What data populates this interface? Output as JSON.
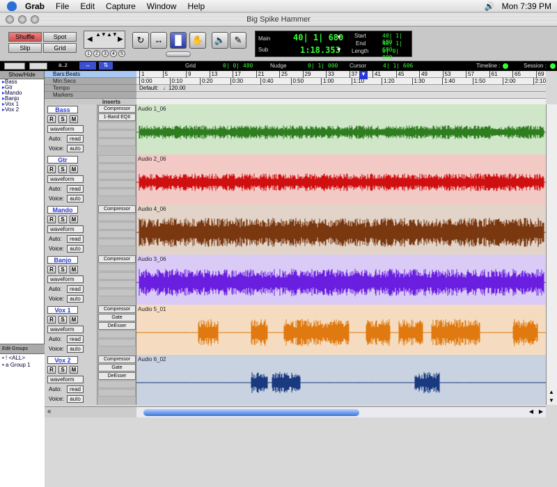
{
  "menubar": {
    "app": "Grab",
    "items": [
      "File",
      "Edit",
      "Capture",
      "Window",
      "Help"
    ],
    "clock": "Mon 7:39 PM"
  },
  "window": {
    "title": "Big Spike Hammer"
  },
  "edit_modes": {
    "shuffle": "Shuffle",
    "spot": "Spot",
    "slip": "Slip",
    "grid": "Grid"
  },
  "zoom_presets": [
    "1",
    "2",
    "3",
    "4",
    "5"
  ],
  "counter": {
    "main_label": "Main",
    "main_value": "40| 1| 680",
    "sub_label": "Sub",
    "sub_value": "1:18.353",
    "start_label": "Start",
    "start_value": "40| 1| 680",
    "end_label": "End",
    "end_value": "40| 1| 680",
    "length_label": "Length",
    "length_value": "0| 0| 000"
  },
  "strip": {
    "grid_label": "Grid",
    "grid_value": "0| 0| 480",
    "nudge_label": "Nudge",
    "nudge_value": "0| 1| 000",
    "cursor_label": "Cursor",
    "cursor_value": "4| 1| 606",
    "timeline_label": "Timeline :",
    "session_label": "Session :",
    "sort_label": "a..z"
  },
  "show_hide": {
    "title": "Show/Hide",
    "tracks": [
      "Bass",
      "Gtr",
      "Mando",
      "Banjo",
      "Vox 1",
      "Vox 2"
    ]
  },
  "edit_groups": {
    "title": "Edit Groups",
    "items": [
      "! <ALL>",
      "a Group 1"
    ]
  },
  "rulers": {
    "labels": [
      "Bars:Beats",
      "Min:Secs",
      "Tempo",
      "Markers"
    ],
    "bars_ticks": [
      "1",
      "5",
      "9",
      "13",
      "17",
      "21",
      "25",
      "29",
      "33",
      "37",
      "41",
      "45",
      "49",
      "53",
      "57",
      "61",
      "65",
      "69"
    ],
    "minsec_ticks": [
      "0:00",
      "0:10",
      "0:20",
      "0:30",
      "0:40",
      "0:50",
      "1:00",
      "1:10",
      "1:20",
      "1:30",
      "1:40",
      "1:50",
      "2:00",
      "2:10"
    ],
    "tempo_text": "Default:",
    "tempo_value": "120.00"
  },
  "inserts_header": "inserts",
  "tracks": [
    {
      "name": "Bass",
      "clip": "Audio 1_06",
      "color": "#2e7d1f",
      "bg": "#cfe6c8",
      "inserts": [
        "Compressor",
        "1-Band EQII"
      ],
      "view": "waveform",
      "auto": "read",
      "voice": "auto"
    },
    {
      "name": "Gtr",
      "clip": "Audio 2_06",
      "color": "#d01010",
      "bg": "#f3c9c6",
      "inserts": [],
      "view": "waveform",
      "auto": "read",
      "voice": "auto"
    },
    {
      "name": "Mando",
      "clip": "Audio 4_06",
      "color": "#7a3810",
      "bg": "#e2d4c8",
      "inserts": [
        "Compressor"
      ],
      "view": "waveform",
      "auto": "read",
      "voice": "auto"
    },
    {
      "name": "Banjo",
      "clip": "Audio 3_06",
      "color": "#6a1ee0",
      "bg": "#dacbf6",
      "inserts": [
        "Compressor"
      ],
      "view": "waveform",
      "auto": "read",
      "voice": "auto"
    },
    {
      "name": "Vox 1",
      "clip": "Audio 5_01",
      "color": "#e07a10",
      "bg": "#f5dcc0",
      "inserts": [
        "Compressor",
        "Gate",
        "DeEsser"
      ],
      "view": "waveform",
      "auto": "read",
      "voice": "auto"
    },
    {
      "name": "Vox 2",
      "clip": "Audio 6_02",
      "color": "#1a3a80",
      "bg": "#c8d2e0",
      "inserts": [
        "Compressor",
        "Gate",
        "DeEsser"
      ],
      "view": "waveform",
      "auto": "read",
      "voice": "auto"
    }
  ],
  "button_labels": {
    "r": "R",
    "s": "S",
    "m": "M",
    "auto": "Auto:",
    "voice": "Voice:"
  }
}
